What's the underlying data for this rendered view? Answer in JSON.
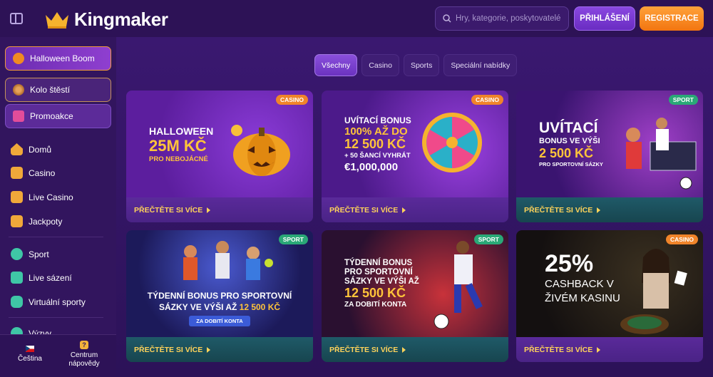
{
  "header": {
    "brand": "Kingmaker",
    "search_placeholder": "Hry, kategorie, poskytovatelé",
    "login_label": "PŘIHLÁŠENÍ",
    "register_label": "REGISTRACE"
  },
  "sidebar": {
    "featured": [
      {
        "label": "Halloween Boom",
        "icon": "pumpkin-icon"
      },
      {
        "label": "Kolo štěstí",
        "icon": "wheel-icon"
      },
      {
        "label": "Promoakce",
        "icon": "gift-icon"
      }
    ],
    "items": [
      {
        "label": "Domů",
        "icon": "home-icon"
      },
      {
        "label": "Casino",
        "icon": "slot-machine-icon"
      },
      {
        "label": "Live Casino",
        "icon": "live-cards-icon"
      },
      {
        "label": "Jackpoty",
        "icon": "jackpot-777-icon"
      },
      {
        "label": "Sport",
        "icon": "football-icon"
      },
      {
        "label": "Live sázení",
        "icon": "live-play-icon"
      },
      {
        "label": "Virtuální sporty",
        "icon": "gamepad-icon"
      },
      {
        "label": "Výzvy",
        "icon": "challenge-icon"
      }
    ],
    "footer": {
      "language": "Čeština",
      "help_line1": "Centrum",
      "help_line2": "nápovědy"
    }
  },
  "filters": [
    "Všechny",
    "Casino",
    "Sports",
    "Speciální nabídky"
  ],
  "active_filter": "Všechny",
  "promos": [
    {
      "badge": "CASINO",
      "lines": [
        "HALLOWEEN",
        "25M KČ",
        "PRO NEBOJÁCNÉ"
      ],
      "cta": "PŘEČTĚTE SI VÍCE"
    },
    {
      "badge": "CASINO",
      "lines": [
        "UVÍTACÍ BONUS",
        "100% AŽ DO",
        "12 500 KČ",
        "+ 50 ŠANCÍ VYHRÁT",
        "€1,000,000"
      ],
      "cta": "PŘEČTĚTE SI VÍCE"
    },
    {
      "badge": "SPORT",
      "lines": [
        "UVÍTACÍ",
        "BONUS VE VÝŠI",
        "2 500 KČ",
        "PRO SPORTOVNÍ SÁZKY"
      ],
      "cta": "PŘEČTĚTE SI VÍCE"
    },
    {
      "badge": "SPORT",
      "lines": [
        "TÝDENNÍ BONUS PRO SPORTOVNÍ",
        "SÁZKY VE VÝŠI AŽ",
        "12 500 KČ",
        "ZA DOBITÍ KONTA"
      ],
      "cta": "PŘEČTĚTE SI VÍCE"
    },
    {
      "badge": "SPORT",
      "lines": [
        "TÝDENNÍ BONUS",
        "PRO SPORTOVNÍ",
        "SÁZKY VE VÝŠI AŽ",
        "12 500 KČ",
        "ZA DOBITÍ KONTA"
      ],
      "cta": "PŘEČTĚTE SI VÍCE"
    },
    {
      "badge": "CASINO",
      "lines": [
        "25%",
        "CASHBACK V",
        "ŽIVÉM KASINU"
      ],
      "cta": "PŘEČTĚTE SI VÍCE"
    }
  ],
  "colors": {
    "accent_orange": "#f27510",
    "accent_purple": "#6b33c0",
    "cta_yellow": "#ffd35a",
    "sport_badge": "#2aa877",
    "casino_badge": "#f0842a"
  }
}
